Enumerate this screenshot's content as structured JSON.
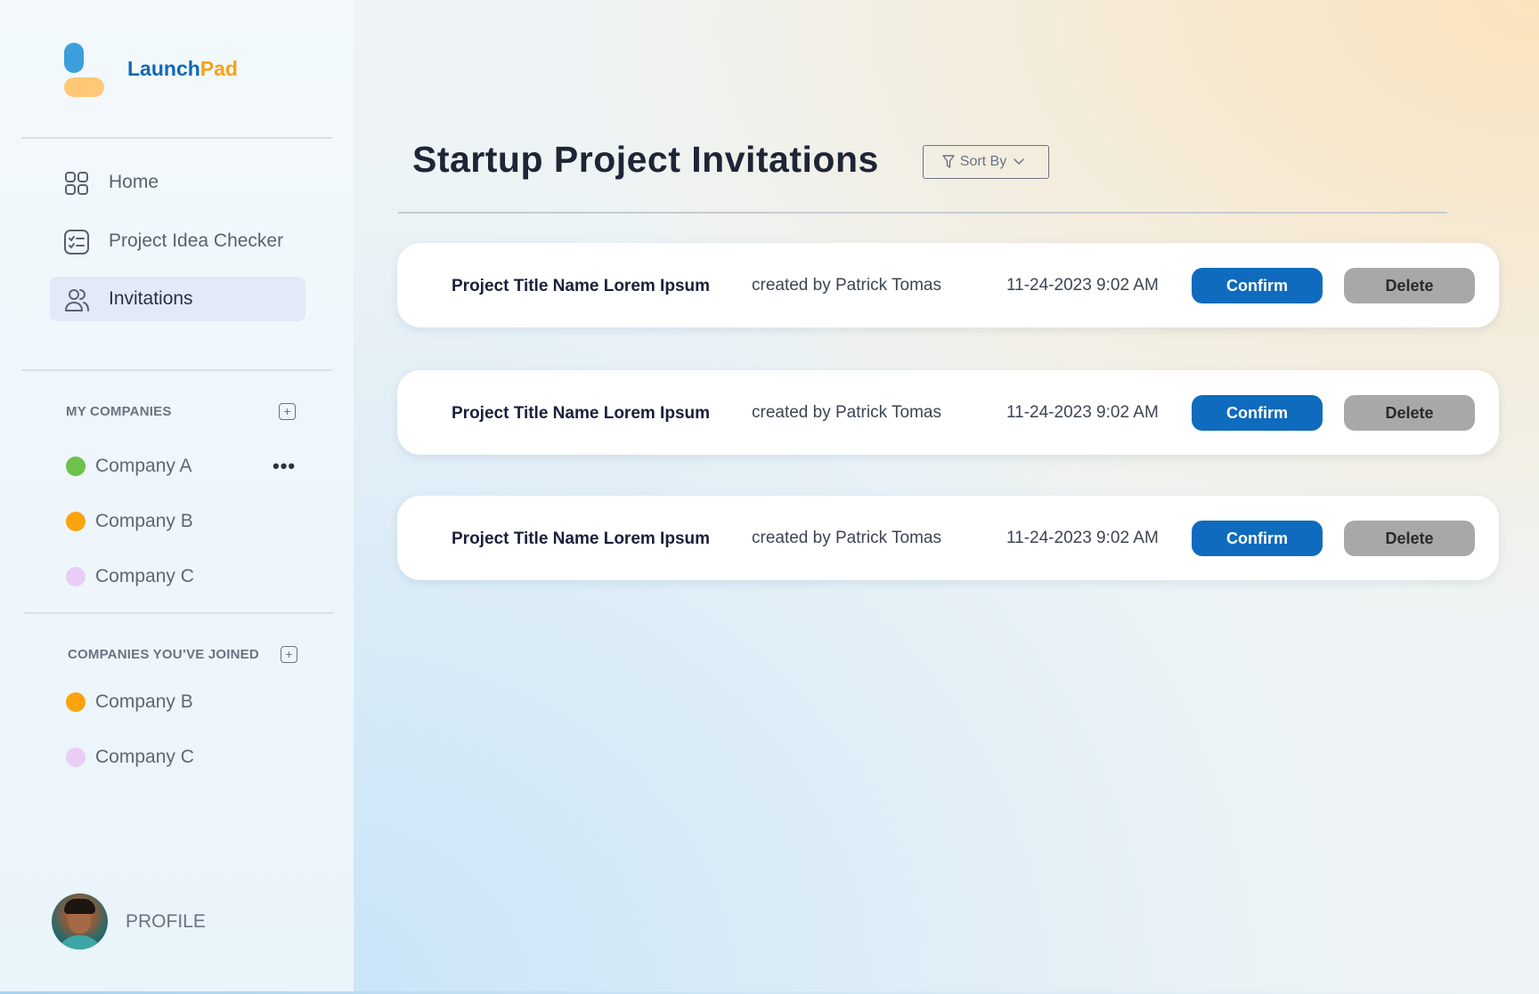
{
  "brand": {
    "part1": "Launch",
    "part2": "Pad",
    "primary_color": "#0e69b8",
    "accent_color": "#f7a21b"
  },
  "nav": {
    "items": [
      {
        "label": "Home",
        "icon": "grid-icon",
        "active": false
      },
      {
        "label": "Project Idea Checker",
        "icon": "checklist-icon",
        "active": false
      },
      {
        "label": "Invitations",
        "icon": "users-icon",
        "active": true
      }
    ]
  },
  "my_companies": {
    "title": "MY COMPANIES",
    "items": [
      {
        "name": "Company A",
        "color": "#6cc24a"
      },
      {
        "name": "Company B",
        "color": "#fba30f"
      },
      {
        "name": "Company C",
        "color": "#e8cdf6"
      }
    ]
  },
  "joined_companies": {
    "title": "COMPANIES YOU’VE JOINED",
    "items": [
      {
        "name": "Company B",
        "color": "#fba30f"
      },
      {
        "name": "Company C",
        "color": "#e8cdf6"
      }
    ]
  },
  "profile": {
    "label": "PROFILE"
  },
  "main": {
    "title": "Startup Project Invitations",
    "sort_label": "Sort By",
    "invitations": [
      {
        "title": "Project Title Name Lorem Ipsum",
        "creator": "created by Patrick Tomas",
        "date": "11-24-2023 9:02 AM",
        "confirm_label": "Confirm",
        "delete_label": "Delete"
      },
      {
        "title": "Project Title Name Lorem Ipsum",
        "creator": "created by Patrick Tomas",
        "date": "11-24-2023 9:02 AM",
        "confirm_label": "Confirm",
        "delete_label": "Delete"
      },
      {
        "title": "Project Title Name Lorem Ipsum",
        "creator": "created by Patrick Tomas",
        "date": "11-24-2023 9:02 AM",
        "confirm_label": "Confirm",
        "delete_label": "Delete"
      }
    ]
  }
}
